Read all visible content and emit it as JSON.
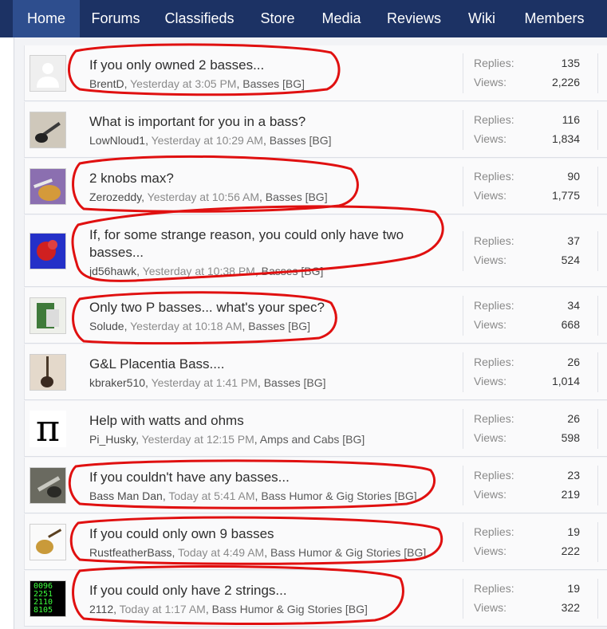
{
  "nav": {
    "items": [
      {
        "label": "Home"
      },
      {
        "label": "Forums"
      },
      {
        "label": "Classifieds"
      },
      {
        "label": "Store"
      },
      {
        "label": "Media"
      },
      {
        "label": "Reviews"
      },
      {
        "label": "Wiki"
      },
      {
        "label": "Members"
      }
    ]
  },
  "threads": [
    {
      "title": "If you only owned 2 basses...",
      "author": "BrentD",
      "time": "Yesterday at 3:05 PM",
      "forum": "Basses [BG]",
      "replies_label": "Replies:",
      "replies": "135",
      "views_label": "Views:",
      "views": "2,226"
    },
    {
      "title": "What is important for you in a bass?",
      "author": "LowNloud1",
      "time": "Yesterday at 10:29 AM",
      "forum": "Basses [BG]",
      "replies_label": "Replies:",
      "replies": "116",
      "views_label": "Views:",
      "views": "1,834"
    },
    {
      "title": "2 knobs max?",
      "author": "Zerozeddy",
      "time": "Yesterday at 10:56 AM",
      "forum": "Basses [BG]",
      "replies_label": "Replies:",
      "replies": "90",
      "views_label": "Views:",
      "views": "1,775"
    },
    {
      "title": "If, for some strange reason, you could only have two basses...",
      "author": "jd56hawk",
      "time": "Yesterday at 10:38 PM",
      "forum": "Basses [BG]",
      "replies_label": "Replies:",
      "replies": "37",
      "views_label": "Views:",
      "views": "524"
    },
    {
      "title": "Only two P basses... what's your spec?",
      "author": "Solude",
      "time": "Yesterday at 10:18 AM",
      "forum": "Basses [BG]",
      "replies_label": "Replies:",
      "replies": "34",
      "views_label": "Views:",
      "views": "668"
    },
    {
      "title": "G&L Placentia Bass....",
      "author": "kbraker510",
      "time": "Yesterday at 1:41 PM",
      "forum": "Basses [BG]",
      "replies_label": "Replies:",
      "replies": "26",
      "views_label": "Views:",
      "views": "1,014"
    },
    {
      "title": "Help with watts and ohms",
      "author": "Pi_Husky",
      "time": "Yesterday at 12:15 PM",
      "forum": "Amps and Cabs [BG]",
      "replies_label": "Replies:",
      "replies": "26",
      "views_label": "Views:",
      "views": "598"
    },
    {
      "title": "If you couldn't have any basses...",
      "author": "Bass Man Dan",
      "time": "Today at 5:41 AM",
      "forum": "Bass Humor & Gig Stories [BG]",
      "replies_label": "Replies:",
      "replies": "23",
      "views_label": "Views:",
      "views": "219"
    },
    {
      "title": "If you could only own 9 basses",
      "author": "RustfeatherBass",
      "time": "Today at 4:49 AM",
      "forum": "Bass Humor & Gig Stories [BG]",
      "replies_label": "Replies:",
      "replies": "19",
      "views_label": "Views:",
      "views": "222"
    },
    {
      "title": "If you could only have 2 strings...",
      "author": "2112",
      "time": "Today at 1:17 AM",
      "forum": "Bass Humor & Gig Stories [BG]",
      "replies_label": "Replies:",
      "replies": "19",
      "views_label": "Views:",
      "views": "322"
    }
  ],
  "avatars": {
    "pi_symbol": "π",
    "digits": "0096 2251 2110 8105"
  },
  "colors": {
    "nav_bg": "#1c3264",
    "nav_active": "#2e4e8e",
    "annotation": "#e01010"
  }
}
